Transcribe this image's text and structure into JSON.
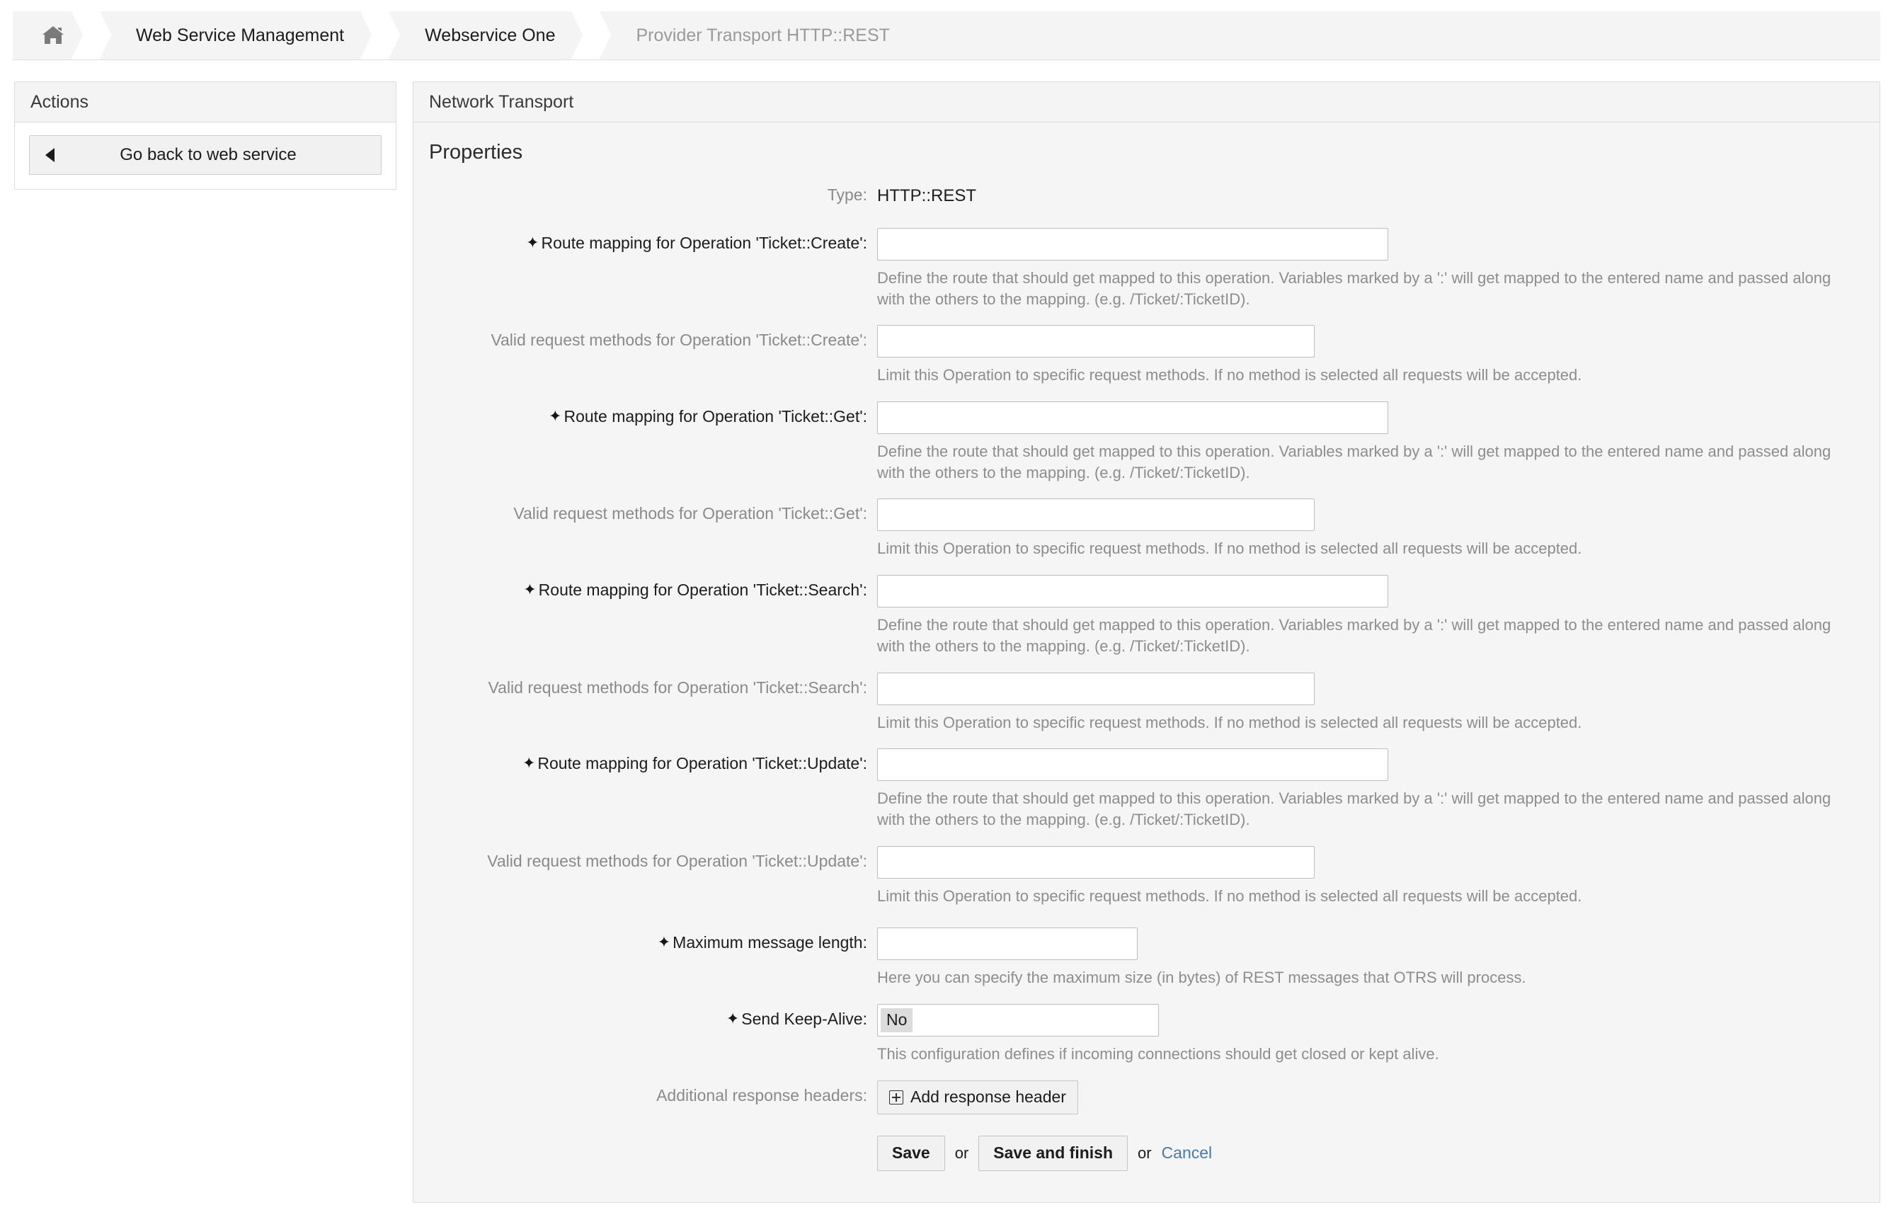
{
  "breadcrumb": {
    "home_icon": "home-icon",
    "items": [
      {
        "label": "Web Service Management",
        "current": false
      },
      {
        "label": "Webservice One",
        "current": false
      },
      {
        "label": "Provider Transport HTTP::REST",
        "current": true
      }
    ]
  },
  "sidebar": {
    "title": "Actions",
    "back_button": {
      "label": "Go back to web service",
      "icon": "left-arrow-icon"
    }
  },
  "content": {
    "header": "Network Transport",
    "section_title": "Properties",
    "type_label": "Type:",
    "type_value": "HTTP::REST",
    "route_help": "Define the route that should get mapped to this operation. Variables marked by a ':' will get mapped to the entered name and passed along with the others to the mapping. (e.g. /Ticket/:TicketID).",
    "methods_help": "Limit this Operation to specific request methods. If no method is selected all requests will be accepted.",
    "operations": [
      {
        "route_label": "Route mapping for Operation 'Ticket::Create':",
        "route_value": "",
        "route_placeholder": "",
        "methods_label": "Valid request methods for Operation 'Ticket::Create':",
        "methods_value": "",
        "methods_placeholder": ""
      },
      {
        "route_label": "Route mapping for Operation 'Ticket::Get':",
        "route_value": "",
        "route_placeholder": "",
        "methods_label": "Valid request methods for Operation 'Ticket::Get':",
        "methods_value": "",
        "methods_placeholder": ""
      },
      {
        "route_label": "Route mapping for Operation 'Ticket::Search':",
        "route_value": "",
        "route_placeholder": "",
        "methods_label": "Valid request methods for Operation 'Ticket::Search':",
        "methods_value": "",
        "methods_placeholder": ""
      },
      {
        "route_label": "Route mapping for Operation 'Ticket::Update':",
        "route_value": "",
        "route_placeholder": "",
        "methods_label": "Valid request methods for Operation 'Ticket::Update':",
        "methods_value": "",
        "methods_placeholder": ""
      }
    ],
    "max_length": {
      "label": "Maximum message length:",
      "value": "",
      "placeholder": "",
      "help": "Here you can specify the maximum size (in bytes) of REST messages that OTRS will process."
    },
    "keep_alive": {
      "label": "Send Keep-Alive:",
      "selected": "No",
      "help": "This configuration defines if incoming connections should get closed or kept alive."
    },
    "response_headers": {
      "label": "Additional response headers:",
      "add_button": "Add response header",
      "add_icon": "plus-box-icon"
    },
    "footer": {
      "save": "Save",
      "or_1": "or",
      "save_and_finish": "Save and finish",
      "or_2": "or",
      "cancel": "Cancel"
    }
  },
  "colors": {
    "panel_bg": "#f5f5f5",
    "header_bg": "#f4f4f4",
    "border": "#dcdcdc",
    "muted_text": "#8d8d8d",
    "link": "#4a7ba0"
  }
}
